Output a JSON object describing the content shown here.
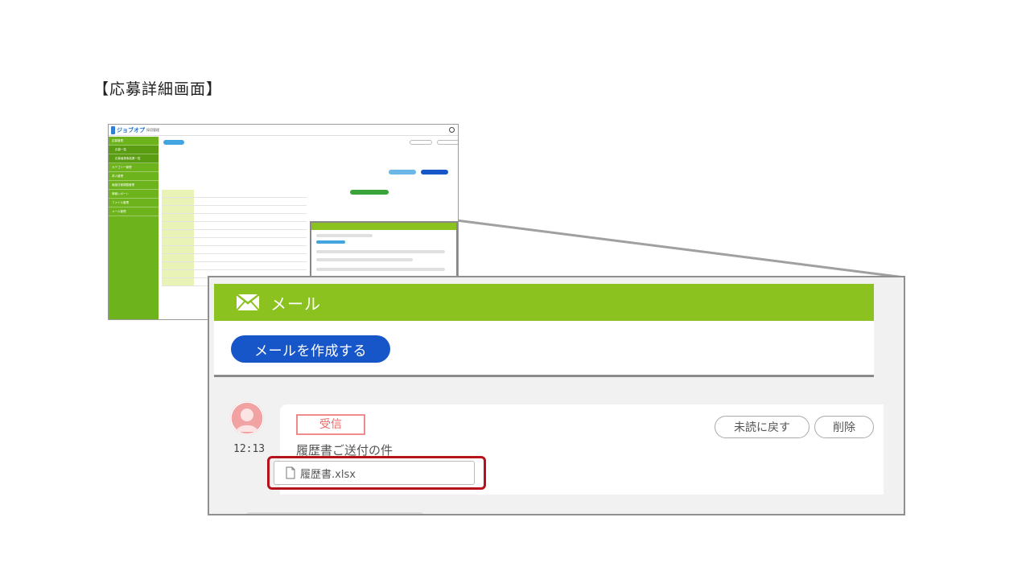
{
  "slide": {
    "title": "【応募詳細画面】"
  },
  "thumbnail": {
    "logo_text": "ジョブオプ",
    "logo_sub": "採用管理",
    "sidebar_items": [
      "応募管理",
      "応募一覧",
      "応募者検索結果一覧",
      "カテゴリー管理",
      "求人管理",
      "面接日程調整管理",
      "情報レポート",
      "ファイル管理",
      "メール管理"
    ],
    "popup_title": "メール"
  },
  "mail_panel": {
    "header_title": "メール",
    "compose_button": "メールを作成する",
    "message": {
      "time": "12:13",
      "badge": "受信",
      "subject": "履歴書ご送付の件",
      "attachment": "履歴書.xlsx",
      "unread_button": "未読に戻す",
      "delete_button": "削除"
    }
  },
  "colors": {
    "green": "#8cc21f",
    "blue_button": "#1756c9",
    "highlight": "#b5121b",
    "badge": "#f08b8b",
    "avatar": "#f1a3a3"
  }
}
